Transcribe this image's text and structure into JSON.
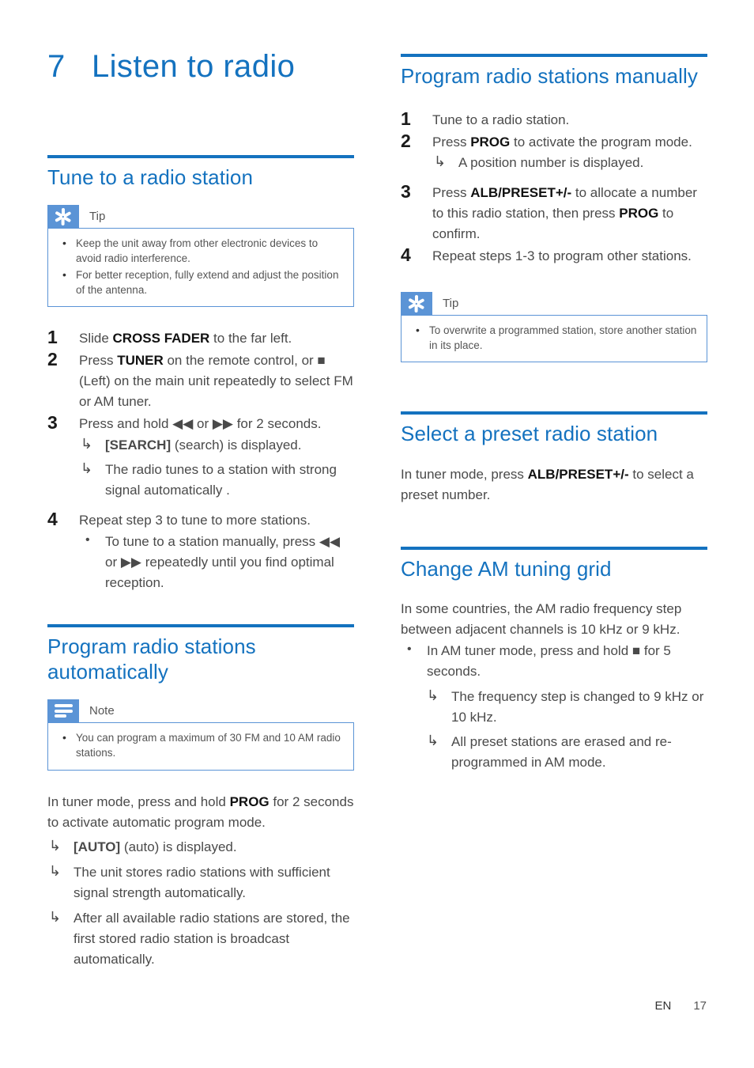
{
  "chapter": {
    "number": "7",
    "title": "Listen to radio"
  },
  "footer": {
    "language": "EN",
    "page_number": "17"
  },
  "colors": {
    "accent_blue": "#1472bf",
    "callout_blue": "#5b94d6",
    "body_text": "#4a4a4a"
  },
  "left_column": {
    "section1": {
      "heading": "Tune to a radio station",
      "callout": {
        "type": "tip",
        "label": "Tip",
        "icon": "asterisk-icon",
        "items": [
          "Keep the unit away from other electronic devices to avoid radio interference.",
          "For better reception, fully extend and adjust the position of the antenna."
        ]
      },
      "steps": [
        {
          "number": "1",
          "parts": [
            {
              "text": "Slide ",
              "bold": false
            },
            {
              "text": "CROSS FADER",
              "bold": true
            },
            {
              "text": " to the far left.",
              "bold": false
            }
          ]
        },
        {
          "number": "2",
          "parts": [
            {
              "text": "Press ",
              "bold": false
            },
            {
              "text": "TUNER",
              "bold": true
            },
            {
              "text": " on the remote control, or ■ (Left) on the main unit repeatedly to select FM or AM tuner.",
              "bold": false
            }
          ]
        },
        {
          "number": "3",
          "parts": [
            {
              "text": "Press and hold ◀◀ or ▶▶ for 2 seconds.",
              "bold": false
            }
          ],
          "results": [
            [
              {
                "text": "[SEARCH]",
                "bold": true
              },
              {
                "text": " (search) is displayed.",
                "bold": false
              }
            ],
            [
              {
                "text": "The radio tunes to a station with strong signal automatically .",
                "bold": false
              }
            ]
          ]
        },
        {
          "number": "4",
          "parts": [
            {
              "text": "Repeat step 3 to tune to more stations.",
              "bold": false
            }
          ],
          "bullets": [
            [
              {
                "text": "To tune to a station manually, press ◀◀ or ▶▶ repeatedly until you find optimal reception.",
                "bold": false
              }
            ]
          ]
        }
      ]
    },
    "section2": {
      "heading": "Program radio stations automatically",
      "callout": {
        "type": "note",
        "label": "Note",
        "icon": "lines-icon",
        "items": [
          "You can program a maximum of 30 FM and 10 AM radio stations."
        ]
      },
      "paragraph": [
        {
          "text": "In tuner mode, press and hold ",
          "bold": false
        },
        {
          "text": "PROG",
          "bold": true
        },
        {
          "text": " for 2 seconds to activate automatic program mode.",
          "bold": false
        }
      ],
      "results": [
        [
          {
            "text": "[AUTO]",
            "bold": true
          },
          {
            "text": " (auto) is displayed.",
            "bold": false
          }
        ],
        [
          {
            "text": "The unit stores radio stations with sufficient signal strength automatically.",
            "bold": false
          }
        ],
        [
          {
            "text": "After all available radio stations are stored, the first stored radio station is broadcast automatically.",
            "bold": false
          }
        ]
      ]
    }
  },
  "right_column": {
    "section1": {
      "heading": "Program radio stations manually",
      "steps": [
        {
          "number": "1",
          "parts": [
            {
              "text": "Tune to a radio station.",
              "bold": false
            }
          ]
        },
        {
          "number": "2",
          "parts": [
            {
              "text": "Press ",
              "bold": false
            },
            {
              "text": "PROG",
              "bold": true
            },
            {
              "text": " to activate the program mode.",
              "bold": false
            }
          ],
          "results": [
            [
              {
                "text": "A position number is displayed.",
                "bold": false
              }
            ]
          ]
        },
        {
          "number": "3",
          "parts": [
            {
              "text": "Press ",
              "bold": false
            },
            {
              "text": "ALB/PRESET+/-",
              "bold": true
            },
            {
              "text": " to allocate a number to this radio station, then press ",
              "bold": false
            },
            {
              "text": "PROG",
              "bold": true
            },
            {
              "text": " to confirm.",
              "bold": false
            }
          ]
        },
        {
          "number": "4",
          "parts": [
            {
              "text": "Repeat steps 1-3 to program other stations.",
              "bold": false
            }
          ]
        }
      ],
      "callout": {
        "type": "tip",
        "label": "Tip",
        "icon": "asterisk-icon",
        "items": [
          "To overwrite a programmed station, store another station in its place."
        ]
      }
    },
    "section2": {
      "heading": "Select a preset radio station",
      "paragraph": [
        {
          "text": "In tuner mode, press ",
          "bold": false
        },
        {
          "text": "ALB/PRESET+/-",
          "bold": true
        },
        {
          "text": " to select a preset number.",
          "bold": false
        }
      ]
    },
    "section3": {
      "heading": "Change AM tuning grid",
      "paragraph": [
        {
          "text": "In some countries, the AM radio frequency step between adjacent channels is 10 kHz or 9 kHz.",
          "bold": false
        }
      ],
      "bullets": [
        [
          {
            "text": "In AM tuner mode, press and hold ■ for 5 seconds.",
            "bold": false
          }
        ]
      ],
      "results": [
        [
          {
            "text": "The frequency step is changed to 9 kHz or 10 kHz.",
            "bold": false
          }
        ],
        [
          {
            "text": "All preset stations are erased and re-programmed in AM mode.",
            "bold": false
          }
        ]
      ]
    }
  }
}
